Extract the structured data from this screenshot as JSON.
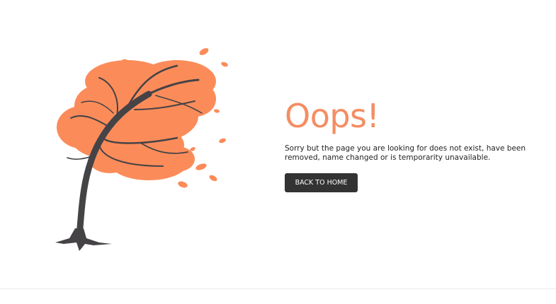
{
  "error": {
    "title": "Oops!",
    "message": "Sorry but the page you are looking for does not exist, have been removed, name changed or is temporarity unavailable.",
    "button_label": "BACK TO HOME"
  },
  "illustration": {
    "icon": "windblown-tree-illustration"
  },
  "colors": {
    "accent": "#f58d63",
    "foliage": "#fb8c5a",
    "trunk": "#454346",
    "button_bg": "#333333",
    "button_text": "#ffffff",
    "text": "#1f1f1f"
  }
}
